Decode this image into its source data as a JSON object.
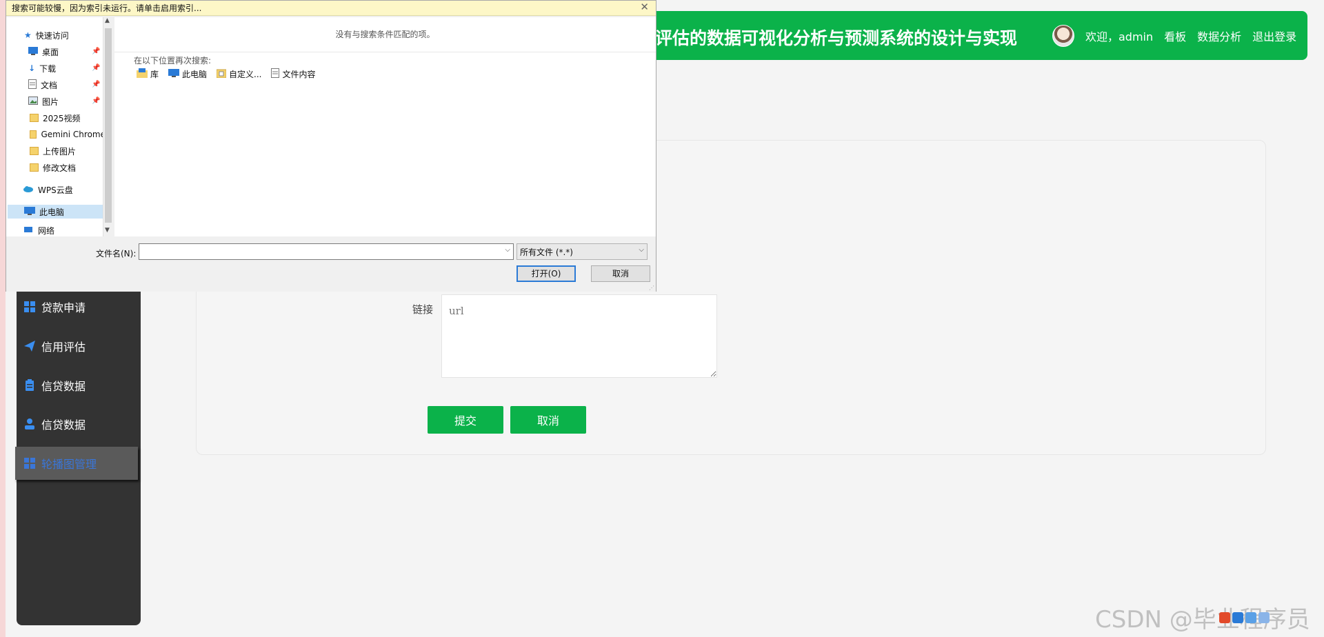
{
  "header": {
    "title": "评估的数据可视化分析与预测系统的设计与实现",
    "welcome": "欢迎，admin",
    "links": [
      "看板",
      "数据分析",
      "退出登录"
    ]
  },
  "sidebar": {
    "items": [
      {
        "label": "贷款申请",
        "icon": "grid-icon"
      },
      {
        "label": "信用评估",
        "icon": "paper-plane-icon"
      },
      {
        "label": "信贷数据",
        "icon": "clipboard-icon"
      },
      {
        "label": "信贷数据",
        "icon": "user-icon"
      },
      {
        "label": "轮播图管理",
        "icon": "grid-icon"
      }
    ],
    "active_index": 4
  },
  "form": {
    "link_label": "链接",
    "link_placeholder": "url",
    "submit_label": "提交",
    "cancel_label": "取消"
  },
  "dialog": {
    "banner": "搜索可能较慢，因为索引未运行。请单击启用索引...",
    "close_glyph": "✕",
    "nav_items": [
      {
        "label": "快速访问",
        "icon": "star-icon",
        "pinned": false
      },
      {
        "label": "桌面",
        "icon": "desktop-icon",
        "pinned": true
      },
      {
        "label": "下载",
        "icon": "download-icon",
        "pinned": true
      },
      {
        "label": "文档",
        "icon": "document-icon",
        "pinned": true
      },
      {
        "label": "图片",
        "icon": "picture-icon",
        "pinned": true
      },
      {
        "label": "2025视频",
        "icon": "folder-icon",
        "pinned": false
      },
      {
        "label": "Gemini Chrome",
        "icon": "folder-icon",
        "pinned": false
      },
      {
        "label": "上传图片",
        "icon": "folder-icon",
        "pinned": false
      },
      {
        "label": "修改文档",
        "icon": "folder-icon",
        "pinned": false
      },
      {
        "label": "WPS云盘",
        "icon": "cloud-icon",
        "pinned": false
      },
      {
        "label": "此电脑",
        "icon": "computer-icon",
        "pinned": false
      },
      {
        "label": "网络",
        "icon": "network-icon",
        "pinned": false
      }
    ],
    "no_match": "没有与搜索条件匹配的项。",
    "search_again_label": "在以下位置再次搜索:",
    "locations": [
      {
        "label": "库",
        "icon": "library-icon"
      },
      {
        "label": "此电脑",
        "icon": "computer-icon"
      },
      {
        "label": "自定义...",
        "icon": "custom-folder-icon"
      },
      {
        "label": "文件内容",
        "icon": "file-content-icon"
      }
    ],
    "filename_label": "文件名(N):",
    "filename_value": "",
    "filetype_value": "所有文件 (*.*)",
    "open_label": "打开(O)",
    "cancel_label": "取消"
  },
  "watermark": "CSDN @毕业程序员",
  "colors": {
    "brand_green": "#0bb24a",
    "sidebar_bg": "#333333",
    "accent_blue": "#3a76d8"
  }
}
